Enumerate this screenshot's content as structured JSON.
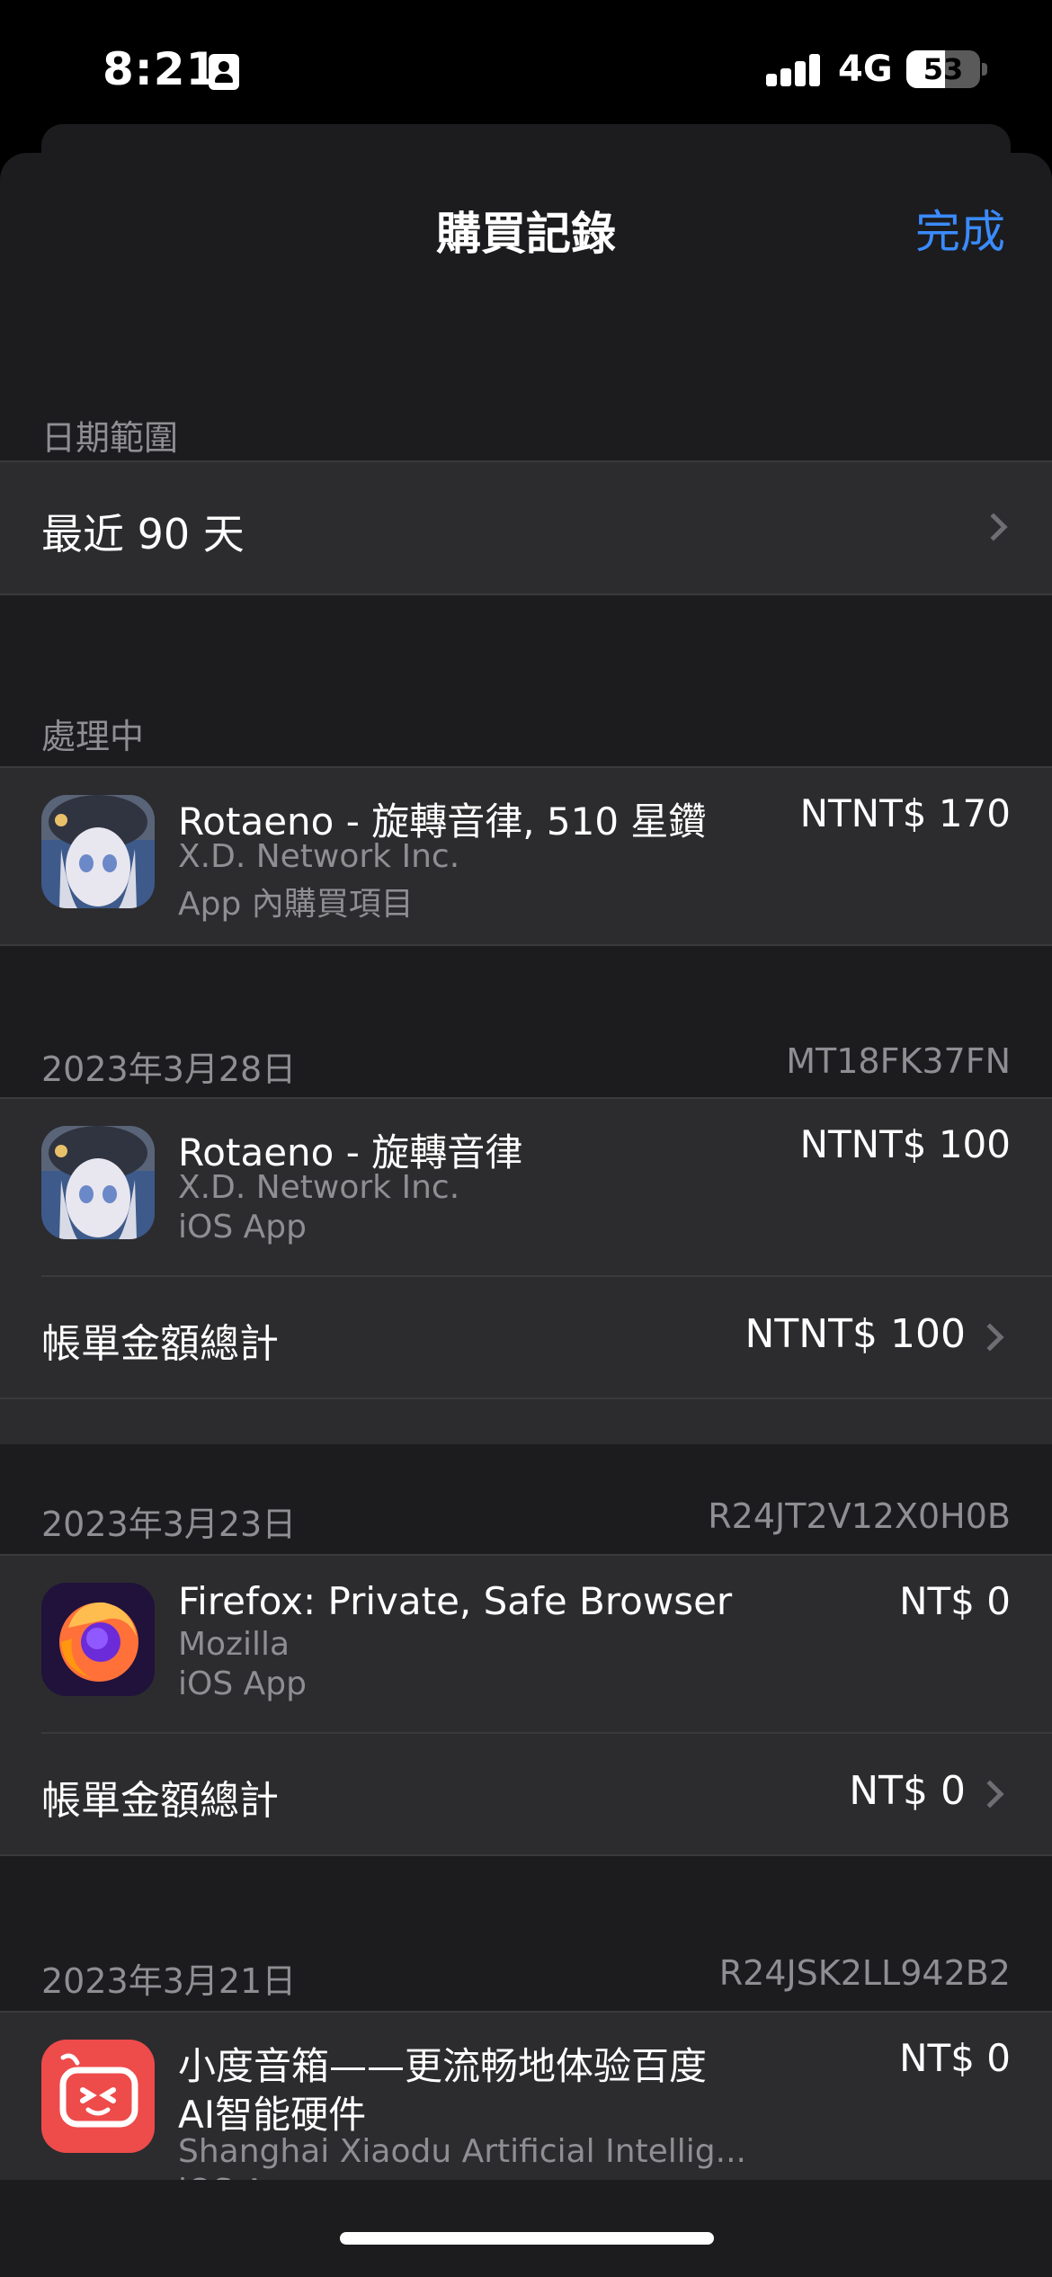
{
  "status_bar": {
    "time": "8:21",
    "network": "4G",
    "battery_level": "53",
    "battery_fraction": 0.53
  },
  "nav": {
    "title": "購買記錄",
    "done_label": "完成"
  },
  "date_range": {
    "header": "日期範圍",
    "value": "最近 90 天"
  },
  "processing": {
    "header": "處理中",
    "items": [
      {
        "title": "Rotaeno - 旋轉音律, 510 星鑽",
        "developer": "X.D. Network Inc.",
        "type": "App 內購買項目",
        "price": "NTNT$ 170",
        "icon": "rotaeno-icon"
      }
    ]
  },
  "purchases": [
    {
      "date": "2023年3月28日",
      "order_id": "MT18FK37FN",
      "title": "Rotaeno - 旋轉音律",
      "developer": "X.D. Network Inc.",
      "type": "iOS App",
      "price": "NTNT$ 100",
      "total_label": "帳單金額總計",
      "total_value": "NTNT$ 100",
      "icon": "rotaeno-icon"
    },
    {
      "date": "2023年3月23日",
      "order_id": "R24JT2V12X0H0B",
      "title": "Firefox: Private, Safe Browser",
      "developer": "Mozilla",
      "type": "iOS App",
      "price": "NT$ 0",
      "total_label": "帳單金額總計",
      "total_value": "NT$ 0",
      "icon": "firefox-icon"
    },
    {
      "date": "2023年3月21日",
      "order_id": "R24JSK2LL942B2",
      "title_line1": "小度音箱——更流畅地体验百度",
      "title_line2": "AI智能硬件",
      "developer": "Shanghai Xiaodu Artificial Intellig...",
      "type": "iOS App",
      "price": "NT$ 0",
      "icon": "xiaodu-icon"
    }
  ],
  "colors": {
    "accent": "#3a8bfd",
    "background": "#1c1c1e",
    "cell": "#2c2c2e",
    "secondary_text": "#8e8e93"
  }
}
